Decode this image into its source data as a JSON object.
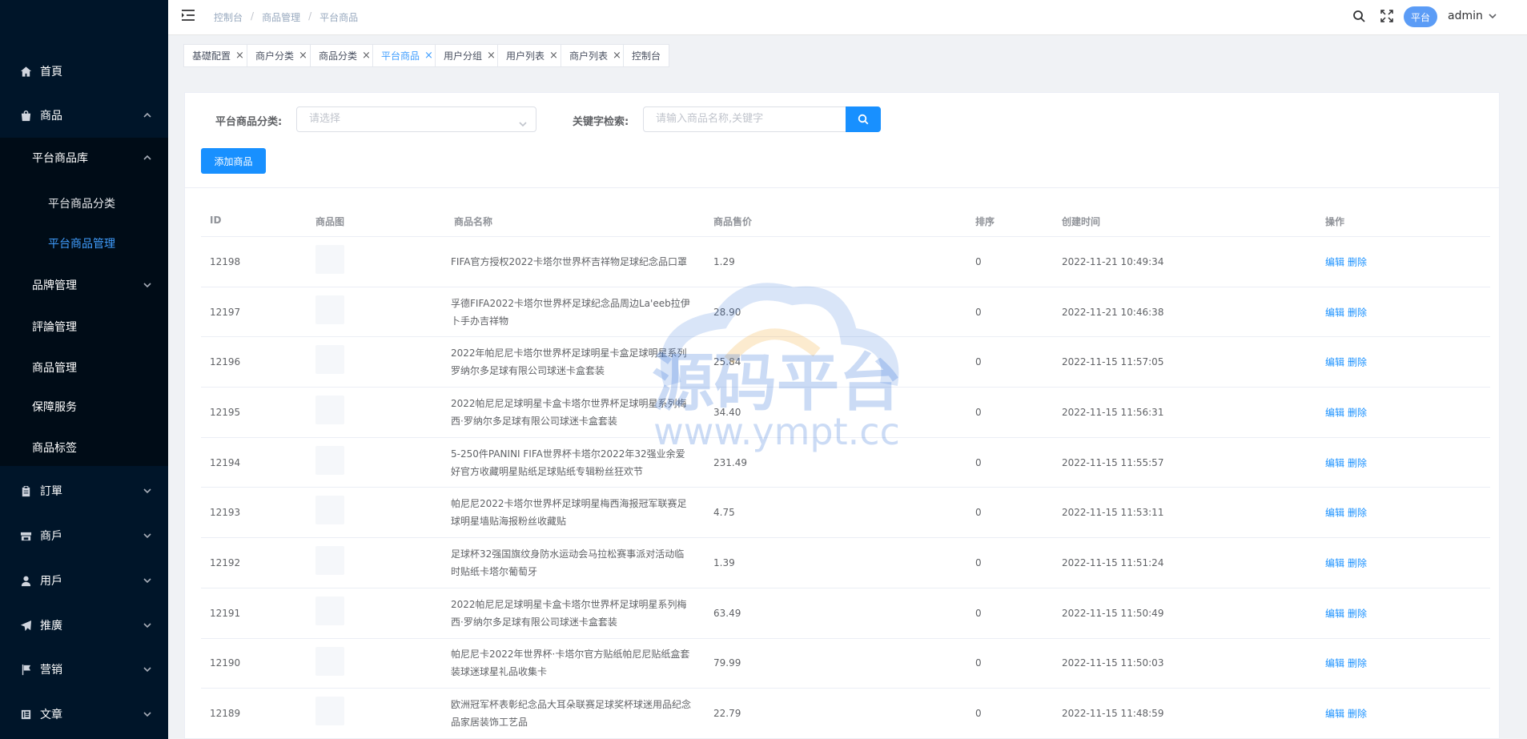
{
  "sidebar": {
    "items": [
      {
        "label": "首頁",
        "icon": "home-icon"
      },
      {
        "label": "商品",
        "icon": "bag-icon"
      },
      {
        "label": "訂單",
        "icon": "clipboard-icon"
      },
      {
        "label": "商戶",
        "icon": "store-icon"
      },
      {
        "label": "用戶",
        "icon": "user-icon"
      },
      {
        "label": "推廣",
        "icon": "send-icon"
      },
      {
        "label": "营销",
        "icon": "flag-icon"
      },
      {
        "label": "文章",
        "icon": "article-icon"
      }
    ],
    "sub": {
      "library": "平台商品库",
      "category": "平台商品分类",
      "manage": "平台商品管理",
      "brand": "品牌管理",
      "review": "評論管理",
      "goods": "商品管理",
      "guarantee": "保障服务",
      "tags": "商品标签"
    }
  },
  "header": {
    "breadcrumb": [
      "控制台",
      "商品管理",
      "平台商品"
    ],
    "badge": "平台",
    "user": "admin"
  },
  "tags": [
    {
      "label": "基礎配置",
      "active": false
    },
    {
      "label": "商户分类",
      "active": false
    },
    {
      "label": "商品分类",
      "active": false
    },
    {
      "label": "平台商品",
      "active": true
    },
    {
      "label": "用户分组",
      "active": false
    },
    {
      "label": "用户列表",
      "active": false
    },
    {
      "label": "商户列表",
      "active": false
    },
    {
      "label": "控制台",
      "active": false
    }
  ],
  "filters": {
    "category_label": "平台商品分类:",
    "category_placeholder": "请选择",
    "keyword_label": "关键字检索:",
    "keyword_placeholder": "请输入商品名称,关键字",
    "add_button": "添加商品"
  },
  "table": {
    "headers": {
      "id": "ID",
      "image": "商品图",
      "name": "商品名称",
      "price": "商品售价",
      "sort": "排序",
      "created": "创建时间",
      "actions": "操作"
    },
    "edit_label": "编辑",
    "delete_label": "删除",
    "rows": [
      {
        "id": "12198",
        "name": "FIFA官方授权2022卡塔尔世界杯吉祥物足球纪念品口罩",
        "price": "1.29",
        "sort": "0",
        "created": "2022-11-21 10:49:34"
      },
      {
        "id": "12197",
        "name": "孚德FIFA2022卡塔尔世界杯足球纪念品周边La'eeb拉伊卜手办吉祥物",
        "price": "28.90",
        "sort": "0",
        "created": "2022-11-21 10:46:38"
      },
      {
        "id": "12196",
        "name": "2022年帕尼尼卡塔尔世界杯足球明星卡盒足球明星系列罗纳尔多足球有限公司球迷卡盒套装",
        "price": "25.84",
        "sort": "0",
        "created": "2022-11-15 11:57:05"
      },
      {
        "id": "12195",
        "name": "2022帕尼尼足球明星卡盒卡塔尔世界杯足球明星系列梅西·罗纳尔多足球有限公司球迷卡盒套装",
        "price": "34.40",
        "sort": "0",
        "created": "2022-11-15 11:56:31"
      },
      {
        "id": "12194",
        "name": "5-250件PANINI FIFA世界杯卡塔尔2022年32强业余爱好官方收藏明星贴纸足球贴纸专辑粉丝狂欢节",
        "price": "231.49",
        "sort": "0",
        "created": "2022-11-15 11:55:57"
      },
      {
        "id": "12193",
        "name": "帕尼尼2022卡塔尔世界杯足球明星梅西海报冠军联赛足球明星墙贴海报粉丝收藏贴",
        "price": "4.75",
        "sort": "0",
        "created": "2022-11-15 11:53:11"
      },
      {
        "id": "12192",
        "name": "足球杯32强国旗纹身防水运动会马拉松赛事派对活动临时贴纸卡塔尔葡萄牙",
        "price": "1.39",
        "sort": "0",
        "created": "2022-11-15 11:51:24"
      },
      {
        "id": "12191",
        "name": "2022帕尼尼足球明星卡盒卡塔尔世界杯足球明星系列梅西·罗纳尔多足球有限公司球迷卡盒套装",
        "price": "63.49",
        "sort": "0",
        "created": "2022-11-15 11:50:49"
      },
      {
        "id": "12190",
        "name": "帕尼尼卡2022年世界杯·卡塔尔官方贴纸帕尼尼贴纸盒套装球迷球星礼品收集卡",
        "price": "79.99",
        "sort": "0",
        "created": "2022-11-15 11:50:03"
      },
      {
        "id": "12189",
        "name": "欧洲冠军杯表彰纪念品大耳朵联赛足球奖杯球迷用品纪念品家居装饰工艺品",
        "price": "22.79",
        "sort": "0",
        "created": "2022-11-15 11:48:59"
      }
    ]
  },
  "watermark": {
    "title": "源码平台",
    "url": "www.ympt.cc",
    "color": "#2f6fd8",
    "accent": "#f5b041"
  }
}
